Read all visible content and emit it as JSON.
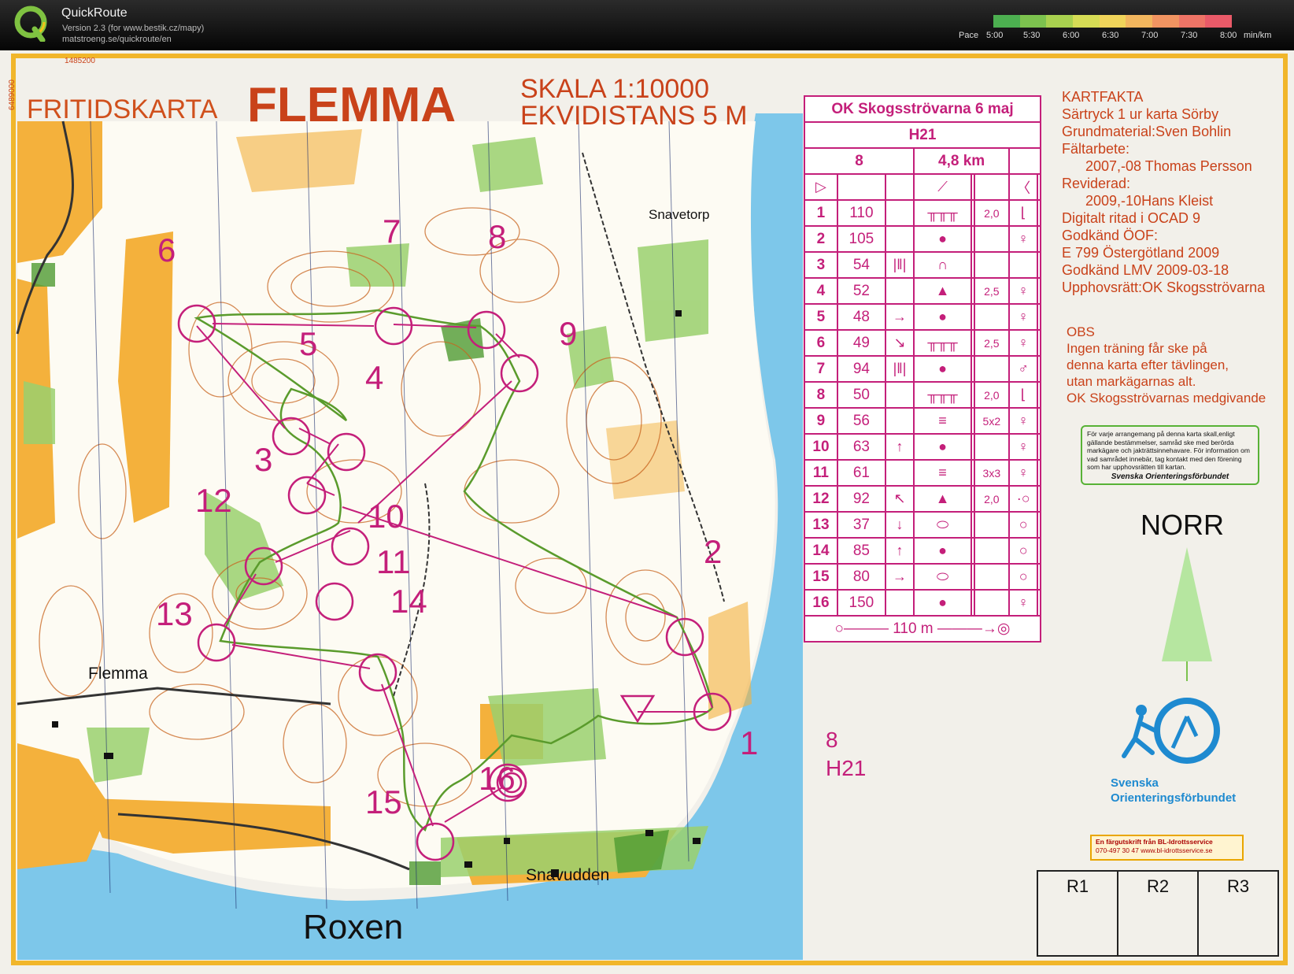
{
  "app": {
    "title": "QuickRoute",
    "version": "Version 2.3  (for www.bestik.cz/mapy)",
    "url": "matstroeng.se/quickroute/en"
  },
  "pace": {
    "label": "Pace",
    "ticks": [
      "5:00",
      "5:30",
      "6:00",
      "6:30",
      "7:00",
      "7:30",
      "8:00"
    ],
    "unit": "min/km",
    "colors": [
      "#4caf50",
      "#7cc24e",
      "#a9d14f",
      "#d6dc55",
      "#f0d45a",
      "#f2b65e",
      "#f19461",
      "#ee7466",
      "#e95a68"
    ]
  },
  "map": {
    "title_prefix": "FRITIDSKARTA",
    "title_name": "FLEMMA",
    "scale": "SKALA 1:10000",
    "contour": "EKVIDISTANS 5 M",
    "coord_x": "1485200",
    "coord_y": "6489000",
    "places": {
      "flemma": "Flemma",
      "snavetorp": "Snavetorp",
      "snavudden": "Snavudden",
      "lake": "Roxen"
    },
    "controls": [
      "1",
      "2",
      "3",
      "4",
      "5",
      "6",
      "7",
      "8",
      "9",
      "10",
      "11",
      "12",
      "13",
      "14",
      "15",
      "16"
    ],
    "class_info": {
      "number": "8",
      "class": "H21"
    }
  },
  "description": {
    "event": "OK  Skogsströvarna 6 maj",
    "class": "H21",
    "course": "8",
    "length": "4,8 km",
    "rows": [
      {
        "n": "1",
        "code": "110",
        "dir": "",
        "feat": "╥╥╥",
        "dim": "2,0",
        "loc": "⌊"
      },
      {
        "n": "2",
        "code": "105",
        "dir": "",
        "feat": "●",
        "dim": "",
        "loc": "♀"
      },
      {
        "n": "3",
        "code": "54",
        "dir": "|‖|",
        "feat": "∩",
        "dim": "",
        "loc": ""
      },
      {
        "n": "4",
        "code": "52",
        "dir": "",
        "feat": "▲",
        "dim": "2,5",
        "loc": "♀"
      },
      {
        "n": "5",
        "code": "48",
        "dir": "→",
        "feat": "●",
        "dim": "",
        "loc": "♀"
      },
      {
        "n": "6",
        "code": "49",
        "dir": "↘",
        "feat": "╥╥╥",
        "dim": "2,5",
        "loc": "♀"
      },
      {
        "n": "7",
        "code": "94",
        "dir": "|‖|",
        "feat": "●",
        "dim": "",
        "loc": "♂"
      },
      {
        "n": "8",
        "code": "50",
        "dir": "",
        "feat": "╥╥╥",
        "dim": "2,0",
        "loc": "⌊"
      },
      {
        "n": "9",
        "code": "56",
        "dir": "",
        "feat": "≡",
        "dim": "5x2",
        "loc": "♀"
      },
      {
        "n": "10",
        "code": "63",
        "dir": "↑",
        "feat": "●",
        "dim": "",
        "loc": "♀"
      },
      {
        "n": "11",
        "code": "61",
        "dir": "",
        "feat": "≡",
        "dim": "3x3",
        "loc": "♀"
      },
      {
        "n": "12",
        "code": "92",
        "dir": "↖",
        "feat": "▲",
        "dim": "2,0",
        "loc": "·○"
      },
      {
        "n": "13",
        "code": "37",
        "dir": "↓",
        "feat": "⬭",
        "dim": "",
        "loc": "○"
      },
      {
        "n": "14",
        "code": "85",
        "dir": "↑",
        "feat": "●",
        "dim": "",
        "loc": "○"
      },
      {
        "n": "15",
        "code": "80",
        "dir": "→",
        "feat": "⬭",
        "dim": "",
        "loc": "○"
      },
      {
        "n": "16",
        "code": "150",
        "dir": "",
        "feat": "●",
        "dim": "",
        "loc": "♀"
      }
    ],
    "finish": "○——— 110 m ———→◎"
  },
  "kartfakta": [
    "KARTFAKTA",
    "Särtryck 1 ur karta Sörby",
    "Grundmaterial:Sven Bohlin",
    "Fältarbete:",
    "      2007,-08 Thomas Persson",
    "Reviderad:",
    "      2009,-10Hans Kleist",
    "Digitalt ritad i OCAD 9",
    "Godkänd ÖOF:",
    "E 799 Östergötland 2009",
    "Godkänd LMV 2009-03-18",
    "Upphovsrätt:OK Skogsströvarna"
  ],
  "obs": [
    "OBS",
    "Ingen träning får ske på",
    "denna karta efter tävlingen,",
    "utan markägarnas alt.",
    "OK Skogsströvarnas medgivande"
  ],
  "notice": "För varje arrangemang på denna karta skall,enligt gällande bestämmelser, samråd ske med berörda markägare och jakträttsinnehavare. För information om vad samrådet innebär, tag kontakt med den förening som har upphovsrätten till kartan.",
  "notice_sign": "Svenska Orienteringsförbundet",
  "north": "NORR",
  "federation": [
    "Svenska",
    "Orienteringsförbundet"
  ],
  "printer": [
    "En färgutskrift från BL-Idrottsservice",
    "070-497 30 47          www.bl-idrottsservice.se"
  ],
  "rounds": [
    "R1",
    "R2",
    "R3"
  ]
}
